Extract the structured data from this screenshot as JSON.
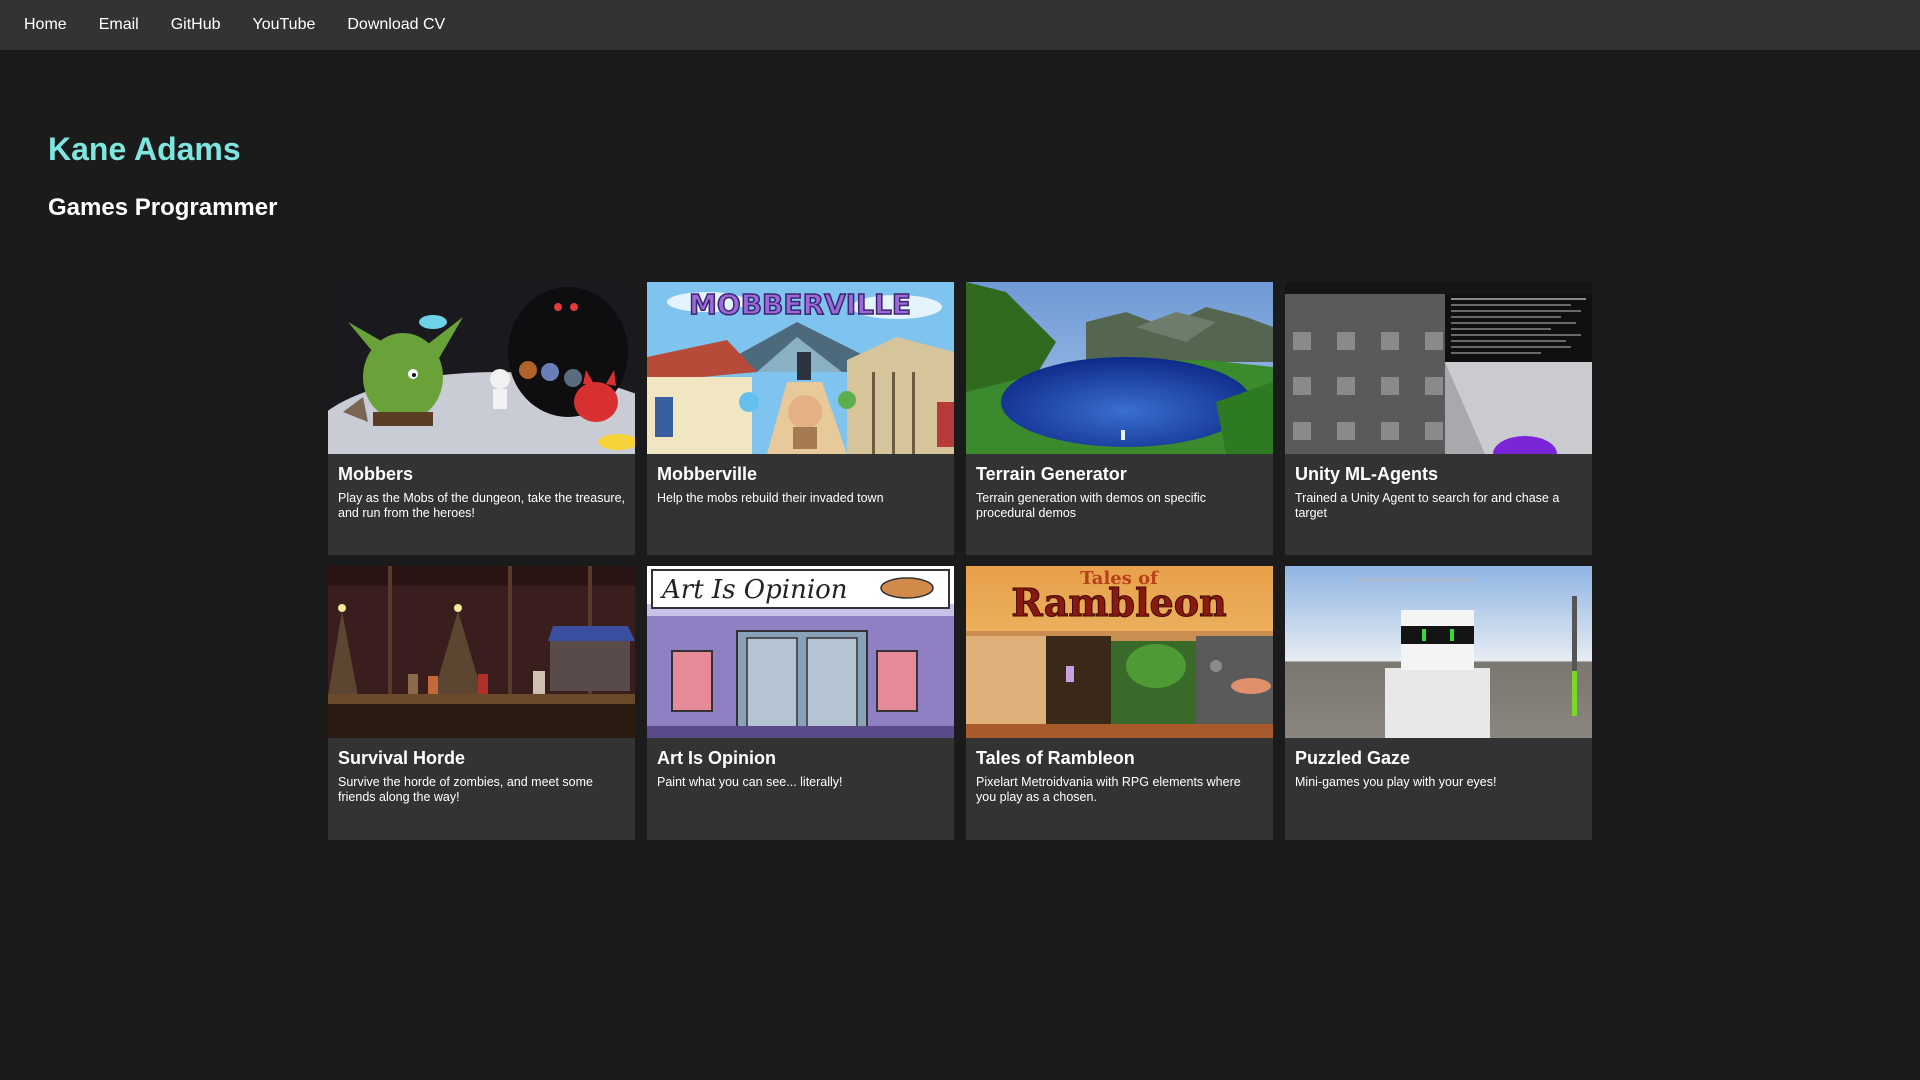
{
  "nav": {
    "items": [
      "Home",
      "Email",
      "GitHub",
      "YouTube",
      "Download CV"
    ]
  },
  "header": {
    "name": "Kane Adams",
    "role": "Games Programmer"
  },
  "projects": [
    {
      "title": "Mobbers",
      "description": "Play as the Mobs of the dungeon, take the treasure, and run from the heroes!",
      "thumbnail_icon": "mobbers-art-icon"
    },
    {
      "title": "Mobberville",
      "description": "Help the mobs rebuild their invaded town",
      "thumbnail_icon": "mobberville-art-icon",
      "thumbnail_text": "MOBBERVILLE"
    },
    {
      "title": "Terrain Generator",
      "description": "Terrain generation with demos on specific procedural demos",
      "thumbnail_icon": "terrain-landscape-icon"
    },
    {
      "title": "Unity ML-Agents",
      "description": "Trained a Unity Agent to search for and chase a target",
      "thumbnail_icon": "ml-agents-screen-icon"
    },
    {
      "title": "Survival Horde",
      "description": "Survive the horde of zombies, and meet some friends along the way!",
      "thumbnail_icon": "survival-horde-scene-icon"
    },
    {
      "title": "Art Is Opinion",
      "description": "Paint what you can see... literally!",
      "thumbnail_icon": "art-gallery-icon",
      "thumbnail_text": "Art Is Opinion"
    },
    {
      "title": "Tales of Rambleon",
      "description": "Pixelart Metroidvania with RPG elements where you play as a chosen.",
      "thumbnail_icon": "rambleon-pixelart-icon",
      "thumbnail_text_top": "Tales of",
      "thumbnail_text_main": "Rambleon"
    },
    {
      "title": "Puzzled Gaze",
      "description": "Mini-games you play with your eyes!",
      "thumbnail_icon": "robot-character-icon"
    }
  ],
  "colors": {
    "background": "#1b1b1b",
    "nav_background": "#333333",
    "card_background": "#333333",
    "name_accent": "#7fe6df"
  }
}
